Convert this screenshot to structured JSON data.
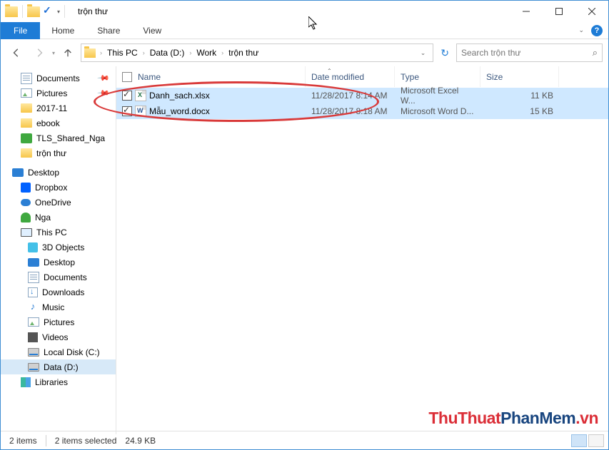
{
  "window": {
    "title": "trộn thư"
  },
  "ribbon": {
    "file": "File",
    "home": "Home",
    "share": "Share",
    "view": "View"
  },
  "breadcrumb": {
    "seg1": "This PC",
    "seg2": "Data (D:)",
    "seg3": "Work",
    "seg4": "trộn thư"
  },
  "search": {
    "placeholder": "Search trộn thư"
  },
  "columns": {
    "name": "Name",
    "date": "Date modified",
    "type": "Type",
    "size": "Size"
  },
  "files": [
    {
      "name": "Danh_sach.xlsx",
      "date": "11/28/2017 8:14 AM",
      "type": "Microsoft Excel W...",
      "size": "11 KB"
    },
    {
      "name": "Mẫu_word.docx",
      "date": "11/28/2017 8:18 AM",
      "type": "Microsoft Word D...",
      "size": "15 KB"
    }
  ],
  "nav": {
    "quick": {
      "documents": "Documents",
      "pictures": "Pictures",
      "f201711": "2017-11",
      "ebook": "ebook",
      "tls": "TLS_Shared_Nga",
      "tronthu": "trộn thư"
    },
    "desktop": "Desktop",
    "dropbox": "Dropbox",
    "onedrive": "OneDrive",
    "nga": "Nga",
    "thispc": "This PC",
    "pc": {
      "d3d": "3D Objects",
      "desktop": "Desktop",
      "documents": "Documents",
      "downloads": "Downloads",
      "music": "Music",
      "pictures": "Pictures",
      "videos": "Videos",
      "localc": "Local Disk (C:)",
      "datad": "Data (D:)"
    },
    "libraries": "Libraries"
  },
  "status": {
    "count": "2 items",
    "selected": "2 items selected",
    "size": "24.9 KB"
  },
  "watermark": {
    "p1": "ThuThuat",
    "p2": "PhanMem",
    "p3": ".vn"
  }
}
